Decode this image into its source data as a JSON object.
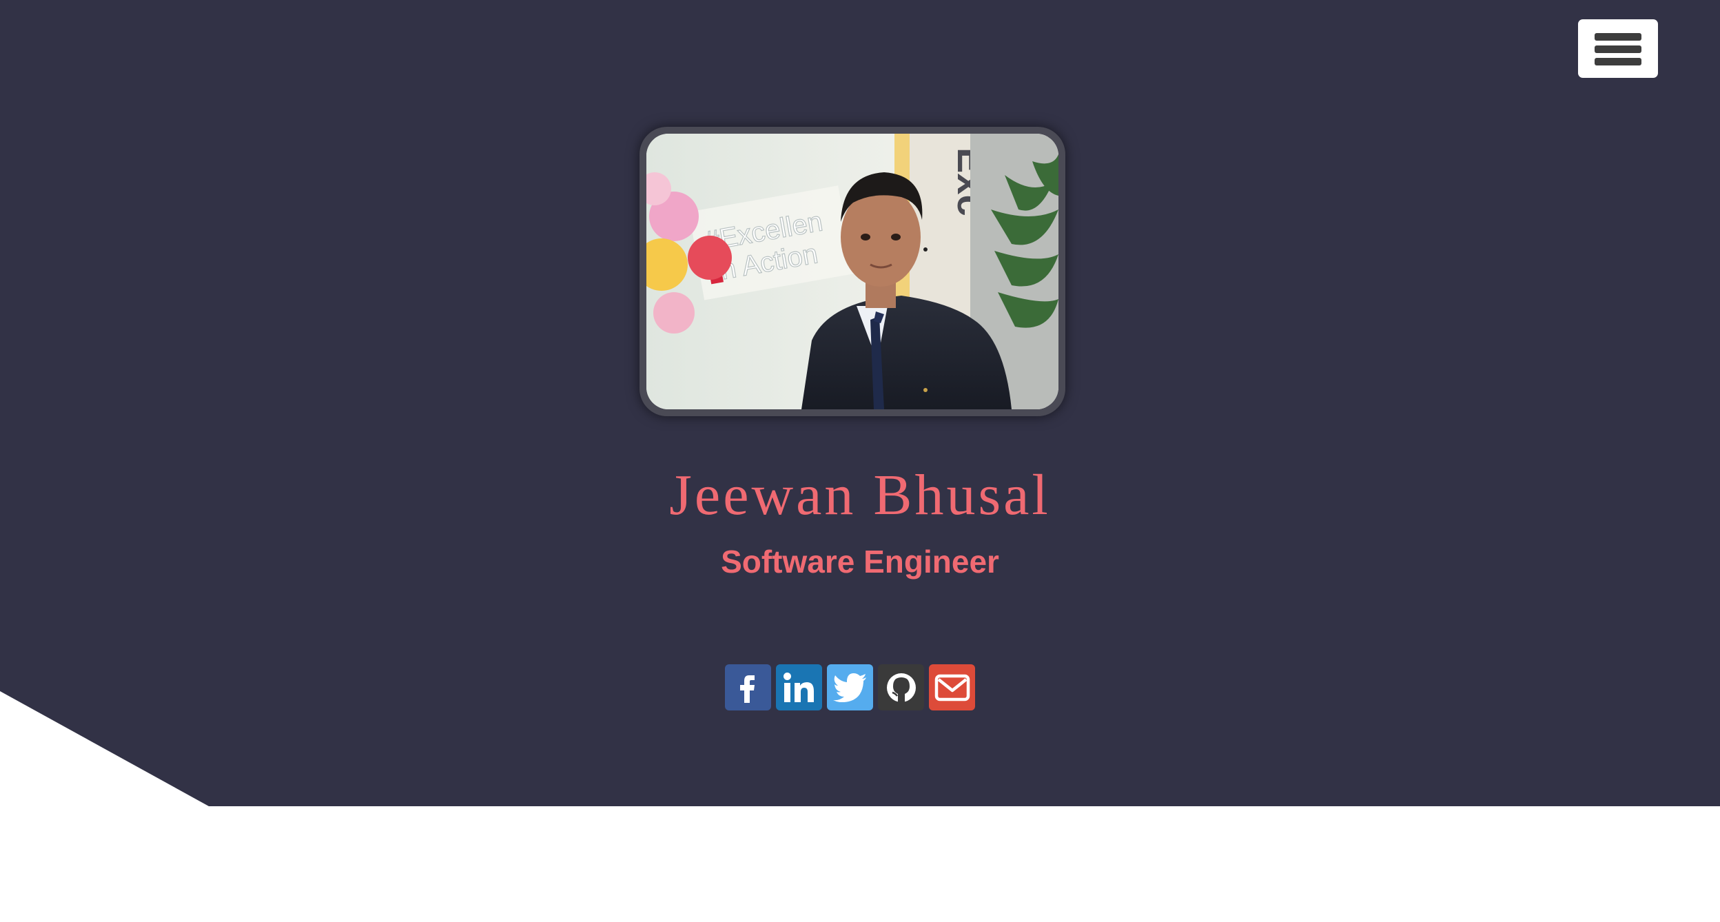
{
  "header": {
    "menu_icon": "hamburger-menu-icon"
  },
  "profile": {
    "photo_alt": "",
    "photo_sign_text": "#Excellence In Action",
    "name": "Jeewan Bhusal",
    "title": "Software Engineer"
  },
  "social": [
    {
      "network": "facebook",
      "icon": "facebook-icon",
      "color": "#3a5998"
    },
    {
      "network": "linkedin",
      "icon": "linkedin-icon",
      "color": "#1a75b3"
    },
    {
      "network": "twitter",
      "icon": "twitter-icon",
      "color": "#55acee"
    },
    {
      "network": "github",
      "icon": "github-icon",
      "color": "#3a3a3a"
    },
    {
      "network": "email",
      "icon": "envelope-icon",
      "color": "#dd4b39"
    }
  ],
  "colors": {
    "hero_background": "#323246",
    "accent": "#f06a72",
    "page_background": "#ffffff"
  }
}
